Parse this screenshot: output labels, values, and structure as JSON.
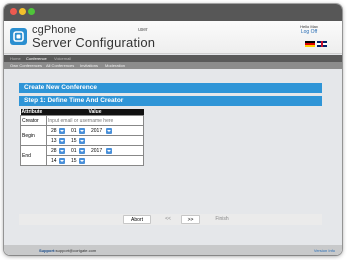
{
  "app": {
    "brand_line1": "cgPhone",
    "brand_line2": "Server Configuration",
    "user_label": "user"
  },
  "account": {
    "hello": "Hello Max",
    "logoff": "Log Off",
    "languages": [
      "de",
      "en"
    ]
  },
  "nav_primary": {
    "items": [
      "Home",
      "Conference",
      "Voicemail"
    ],
    "active": "Conference"
  },
  "nav_secondary": {
    "items": [
      "Own Conferences",
      "All Conferences",
      "Invitations",
      "Moderation"
    ]
  },
  "page": {
    "title": "Create New Conference",
    "step": "Step 1: Define Time And Creator"
  },
  "form": {
    "col_attribute": "Attribute",
    "col_value": "Value",
    "creator_label": "Creator",
    "creator_placeholder": "Input email or username here",
    "begin_label": "Begin",
    "begin_day": "28",
    "begin_month": "01",
    "begin_year": "2017",
    "begin_hour": "13",
    "begin_minute": "15",
    "end_label": "End",
    "end_day": "28",
    "end_month": "01",
    "end_year": "2017",
    "end_hour": "14",
    "end_minute": "15"
  },
  "buttons": {
    "abort": "Abort",
    "prev": "<<",
    "next": ">>",
    "finish": "Finish"
  },
  "footer": {
    "support_label": "Support:",
    "support_email": "support@cortgate.com",
    "version": "Version Info"
  },
  "colors": {
    "accent": "#2f95d7",
    "titlebar": "#575757",
    "nav_primary": "#5a5a5a",
    "nav_secondary": "#8c8c8c"
  }
}
